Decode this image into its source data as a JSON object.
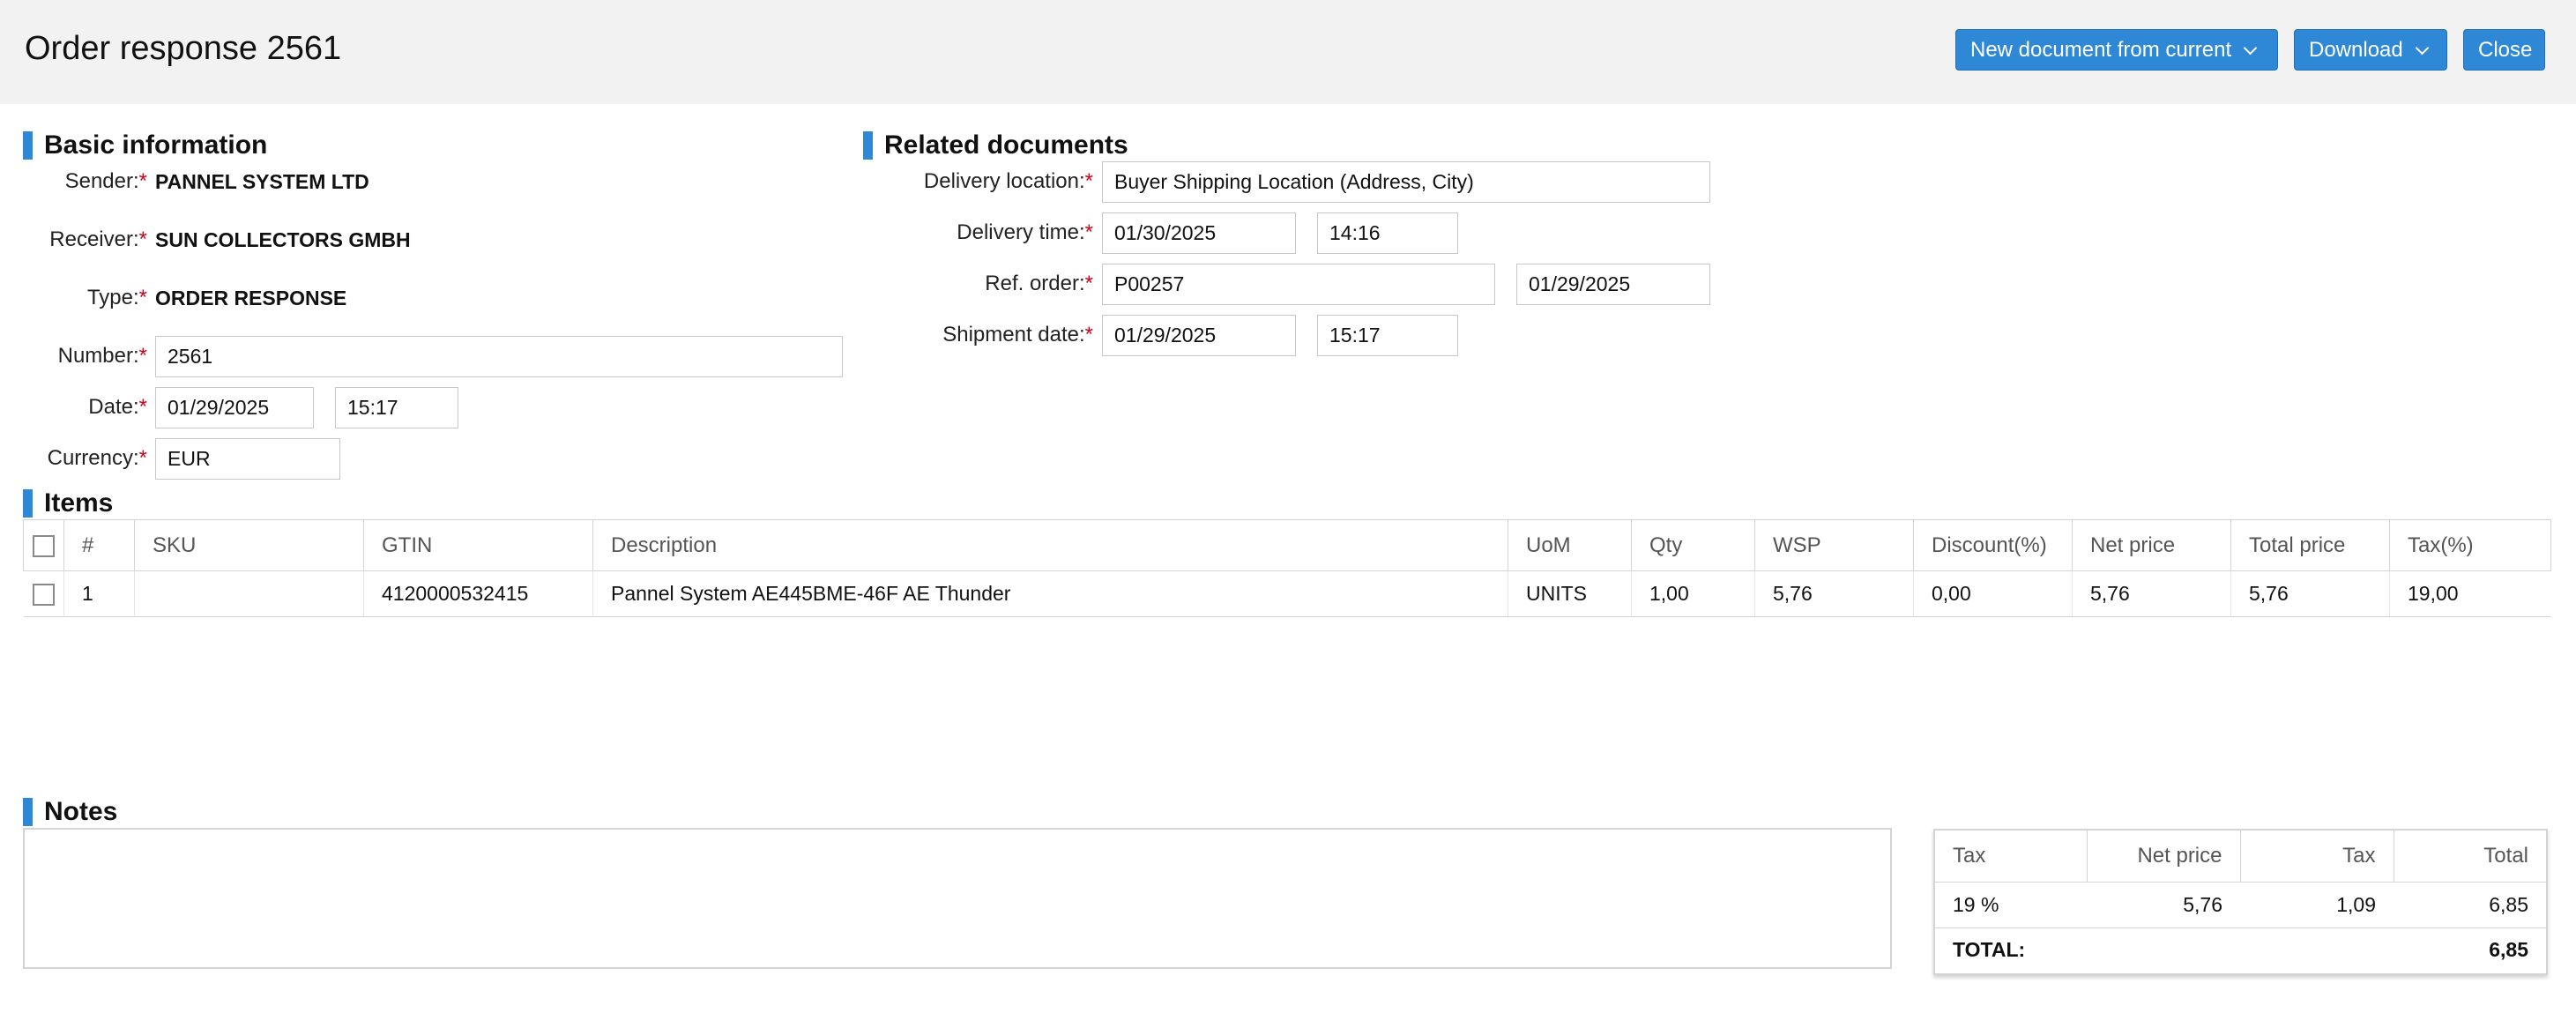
{
  "header": {
    "title": "Order response 2561",
    "buttons": {
      "new_document": "New document from current",
      "download": "Download",
      "close": "Close"
    }
  },
  "basic_info": {
    "section_title": "Basic information",
    "sender_label": "Sender:",
    "sender_value": "PANNEL SYSTEM LTD",
    "receiver_label": "Receiver:",
    "receiver_value": "SUN COLLECTORS GMBH",
    "type_label": "Type:",
    "type_value": "ORDER RESPONSE",
    "number_label": "Number:",
    "number_value": "2561",
    "date_label": "Date:",
    "date_value": "01/29/2025",
    "time_value": "15:17",
    "currency_label": "Currency:",
    "currency_value": "EUR"
  },
  "related": {
    "section_title": "Related documents",
    "delivery_location_label": "Delivery location:",
    "delivery_location_value": "Buyer Shipping Location (Address, City)",
    "delivery_time_label": "Delivery time:",
    "delivery_date_value": "01/30/2025",
    "delivery_time_value": "14:16",
    "ref_order_label": "Ref. order:",
    "ref_order_value": "P00257",
    "ref_order_date_value": "01/29/2025",
    "shipment_date_label": "Shipment date:",
    "shipment_date_value": "01/29/2025",
    "shipment_time_value": "15:17"
  },
  "items": {
    "section_title": "Items",
    "columns": [
      "#",
      "SKU",
      "GTIN",
      "Description",
      "UoM",
      "Qty",
      "WSP",
      "Discount(%)",
      "Net price",
      "Total price",
      "Tax(%)"
    ],
    "rows": [
      [
        "1",
        "",
        "4120000532415",
        "Pannel System AE445BME-46F AE Thunder",
        "UNITS",
        "1,00",
        "5,76",
        "0,00",
        "5,76",
        "5,76",
        "19,00"
      ]
    ]
  },
  "notes": {
    "section_title": "Notes",
    "value": ""
  },
  "tax_summary": {
    "columns": [
      "Tax",
      "Net price",
      "Tax",
      "Total"
    ],
    "rows": [
      [
        "19 %",
        "5,76",
        "1,09",
        "6,85"
      ]
    ],
    "total_label": "TOTAL:",
    "total_value": "6,85"
  },
  "colors": {
    "accent": "#2e88d6",
    "required": "#d0021b",
    "header_bg": "#f2f2f2"
  }
}
